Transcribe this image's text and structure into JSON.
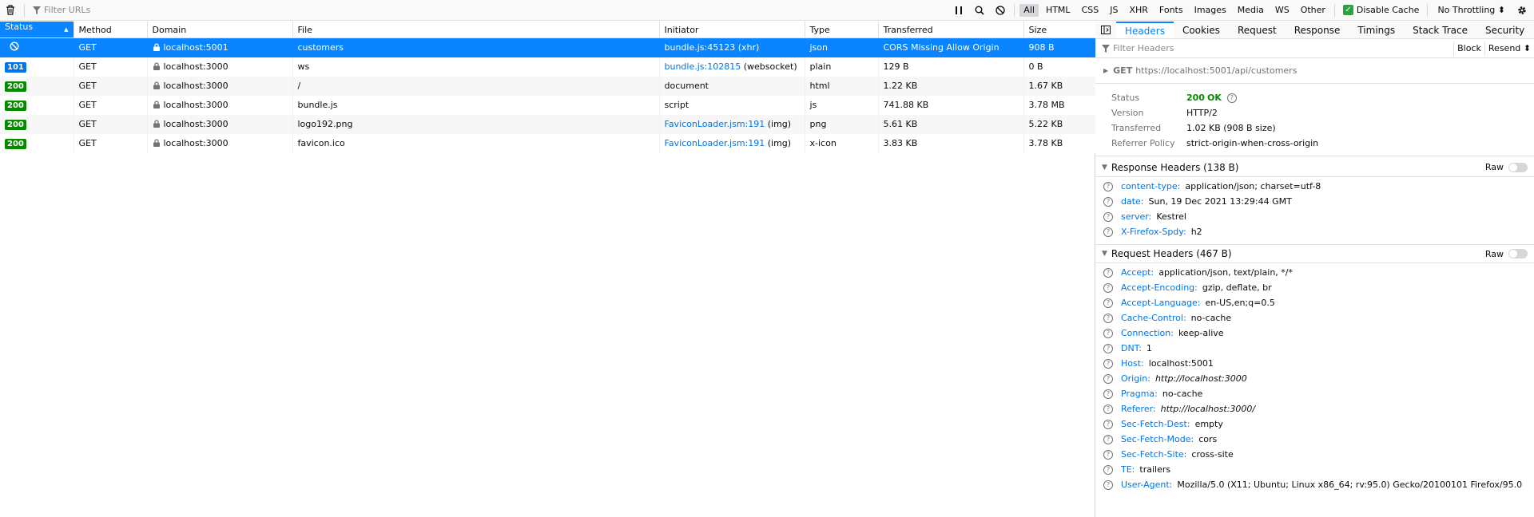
{
  "toolbar": {
    "filter_placeholder": "Filter URLs",
    "types": [
      "All",
      "HTML",
      "CSS",
      "JS",
      "XHR",
      "Fonts",
      "Images",
      "Media",
      "WS",
      "Other"
    ],
    "active_type": "All",
    "disable_cache_label": "Disable Cache",
    "throttling_label": "No Throttling ⬍"
  },
  "columns": [
    "Status",
    "Method",
    "Domain",
    "File",
    "Initiator",
    "Type",
    "Transferred",
    "Size"
  ],
  "requests": [
    {
      "status": "",
      "method": "GET",
      "domain": "localhost:5001",
      "file": "customers",
      "initiator_link": "bundle.js:45123",
      "initiator_suffix": " (xhr)",
      "type": "json",
      "transferred": "CORS Missing Allow Origin",
      "size": "908 B"
    },
    {
      "status": "101",
      "method": "GET",
      "domain": "localhost:3000",
      "file": "ws",
      "initiator_link": "bundle.js:102815",
      "initiator_suffix": " (websocket)",
      "type": "plain",
      "transferred": "129 B",
      "size": "0 B"
    },
    {
      "status": "200",
      "method": "GET",
      "domain": "localhost:3000",
      "file": "/",
      "initiator_link": "",
      "initiator_suffix": "document",
      "type": "html",
      "transferred": "1.22 KB",
      "size": "1.67 KB"
    },
    {
      "status": "200",
      "method": "GET",
      "domain": "localhost:3000",
      "file": "bundle.js",
      "initiator_link": "",
      "initiator_suffix": "script",
      "type": "js",
      "transferred": "741.88 KB",
      "size": "3.78 MB"
    },
    {
      "status": "200",
      "method": "GET",
      "domain": "localhost:3000",
      "file": "logo192.png",
      "initiator_link": "FaviconLoader.jsm:191",
      "initiator_suffix": " (img)",
      "type": "png",
      "transferred": "5.61 KB",
      "size": "5.22 KB"
    },
    {
      "status": "200",
      "method": "GET",
      "domain": "localhost:3000",
      "file": "favicon.ico",
      "initiator_link": "FaviconLoader.jsm:191",
      "initiator_suffix": " (img)",
      "type": "x-icon",
      "transferred": "3.83 KB",
      "size": "3.78 KB"
    }
  ],
  "panel": {
    "tabs": [
      "Headers",
      "Cookies",
      "Request",
      "Response",
      "Timings",
      "Stack Trace",
      "Security"
    ],
    "active_tab": "Headers",
    "filter_placeholder": "Filter Headers",
    "block_label": "Block",
    "resend_label": "Resend ⬍",
    "url_method": "GET",
    "url": "https://localhost:5001/api/customers",
    "summary": {
      "status_key": "Status",
      "status_code": "200",
      "status_text": "OK",
      "version_key": "Version",
      "version": "HTTP/2",
      "transferred_key": "Transferred",
      "transferred": "1.02 KB (908 B size)",
      "referrer_key": "Referrer Policy",
      "referrer": "strict-origin-when-cross-origin"
    },
    "response_headers_title": "Response Headers (138 B)",
    "request_headers_title": "Request Headers (467 B)",
    "raw_label": "Raw",
    "response_headers": [
      {
        "name": "content-type:",
        "value": "application/json; charset=utf-8"
      },
      {
        "name": "date:",
        "value": "Sun, 19 Dec 2021 13:29:44 GMT"
      },
      {
        "name": "server:",
        "value": "Kestrel"
      },
      {
        "name": "X-Firefox-Spdy:",
        "value": "h2"
      }
    ],
    "request_headers": [
      {
        "name": "Accept:",
        "value": "application/json, text/plain, */*"
      },
      {
        "name": "Accept-Encoding:",
        "value": "gzip, deflate, br"
      },
      {
        "name": "Accept-Language:",
        "value": "en-US,en;q=0.5"
      },
      {
        "name": "Cache-Control:",
        "value": "no-cache"
      },
      {
        "name": "Connection:",
        "value": "keep-alive"
      },
      {
        "name": "DNT:",
        "value": "1"
      },
      {
        "name": "Host:",
        "value": "localhost:5001"
      },
      {
        "name": "Origin:",
        "value": "http://localhost:3000",
        "italic": true
      },
      {
        "name": "Pragma:",
        "value": "no-cache"
      },
      {
        "name": "Referer:",
        "value": "http://localhost:3000/",
        "italic": true
      },
      {
        "name": "Sec-Fetch-Dest:",
        "value": "empty"
      },
      {
        "name": "Sec-Fetch-Mode:",
        "value": "cors"
      },
      {
        "name": "Sec-Fetch-Site:",
        "value": "cross-site"
      },
      {
        "name": "TE:",
        "value": "trailers"
      },
      {
        "name": "User-Agent:",
        "value": "Mozilla/5.0 (X11; Ubuntu; Linux x86_64; rv:95.0) Gecko/20100101 Firefox/95.0"
      }
    ]
  }
}
